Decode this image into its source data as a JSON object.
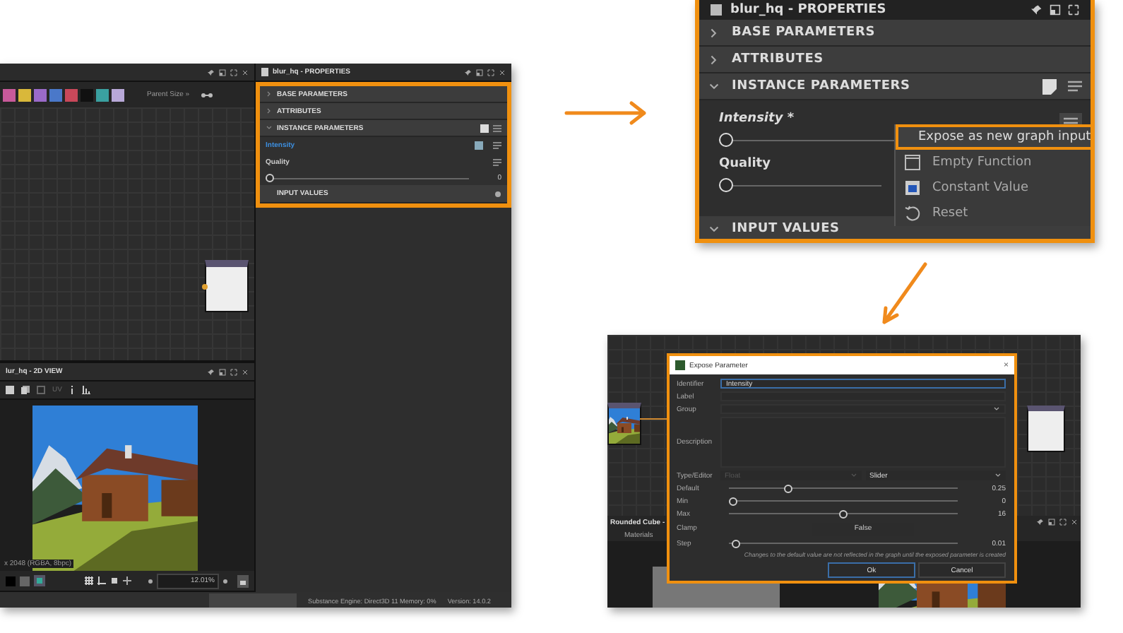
{
  "editor": {
    "graph_panel": {
      "toolbar_label": "Parent Size »"
    },
    "properties": {
      "title": "blur_hq - PROPERTIES",
      "sections": [
        {
          "label": "BASE PARAMETERS",
          "expanded": false
        },
        {
          "label": "ATTRIBUTES",
          "expanded": false
        },
        {
          "label": "INSTANCE PARAMETERS",
          "expanded": true
        }
      ],
      "params": [
        {
          "label": "Intensity",
          "selected": true
        },
        {
          "label": "Quality",
          "selected": false,
          "level": 0,
          "reading": "0"
        }
      ],
      "footer_section": {
        "label": "INPUT VALUES"
      }
    },
    "view_2d": {
      "title": "lur_hq - 2D VIEW",
      "toolbar_label": "UV",
      "image_info": "x 2048 (RGBA, 8bpc)",
      "zoom": "12.01%"
    },
    "status_bar": {
      "engine": "Substance Engine: Direct3D 11  Memory: 0%",
      "version": "Version: 14.0.2"
    }
  },
  "properties_zoom": {
    "title": "blur_hq - PROPERTIES",
    "sections": [
      {
        "label": "BASE PARAMETERS",
        "expanded": false
      },
      {
        "label": "ATTRIBUTES",
        "expanded": false
      },
      {
        "label": "INSTANCE PARAMETERS",
        "expanded": true
      }
    ],
    "params": [
      {
        "label": "Intensity *",
        "level": 0
      },
      {
        "label": "Quality",
        "level": 0
      }
    ],
    "footer_section": {
      "label": "INPUT VALUES"
    },
    "context_menu": [
      {
        "label": "Expose as new graph input",
        "kind": "expose",
        "selected": true
      },
      {
        "label": "Empty Function",
        "kind": "function",
        "selected": false
      },
      {
        "label": "Constant Value",
        "kind": "constant",
        "selected": false
      },
      {
        "label": "Reset",
        "kind": "reset",
        "selected": false
      }
    ]
  },
  "dialog_shot": {
    "background_panel": {
      "title": "Rounded Cube -",
      "tab": "Materials"
    },
    "dialog": {
      "title": "Expose Parameter",
      "close": "×",
      "fields": [
        {
          "label": "Identifier",
          "kind": "text",
          "value": "Intensity"
        },
        {
          "label": "Label",
          "kind": "text"
        },
        {
          "label": "Group",
          "kind": "dropdown"
        },
        {
          "label": "Description",
          "kind": "textarea"
        }
      ],
      "type_editor": {
        "label": "Type/Editor",
        "type": "Float",
        "type_disabled": true,
        "editor": "Slider"
      },
      "rows": [
        {
          "kind": "slider",
          "label": "Default",
          "level": 0.25,
          "reading": "0.25"
        },
        {
          "kind": "slider",
          "label": "Min",
          "level": 0,
          "reading": "0"
        },
        {
          "kind": "slider",
          "label": "Max",
          "level": 0.5,
          "reading": "16"
        },
        {
          "kind": "toggle",
          "label": "Clamp",
          "value": "False"
        },
        {
          "kind": "slider",
          "label": "Step",
          "level": 0.01,
          "reading": "0.01"
        }
      ],
      "note": "Changes to the default value are not reflected in the graph until the exposed parameter is created",
      "buttons": [
        {
          "label": "Ok",
          "selected": true
        },
        {
          "label": "Cancel",
          "selected": false
        }
      ]
    }
  }
}
